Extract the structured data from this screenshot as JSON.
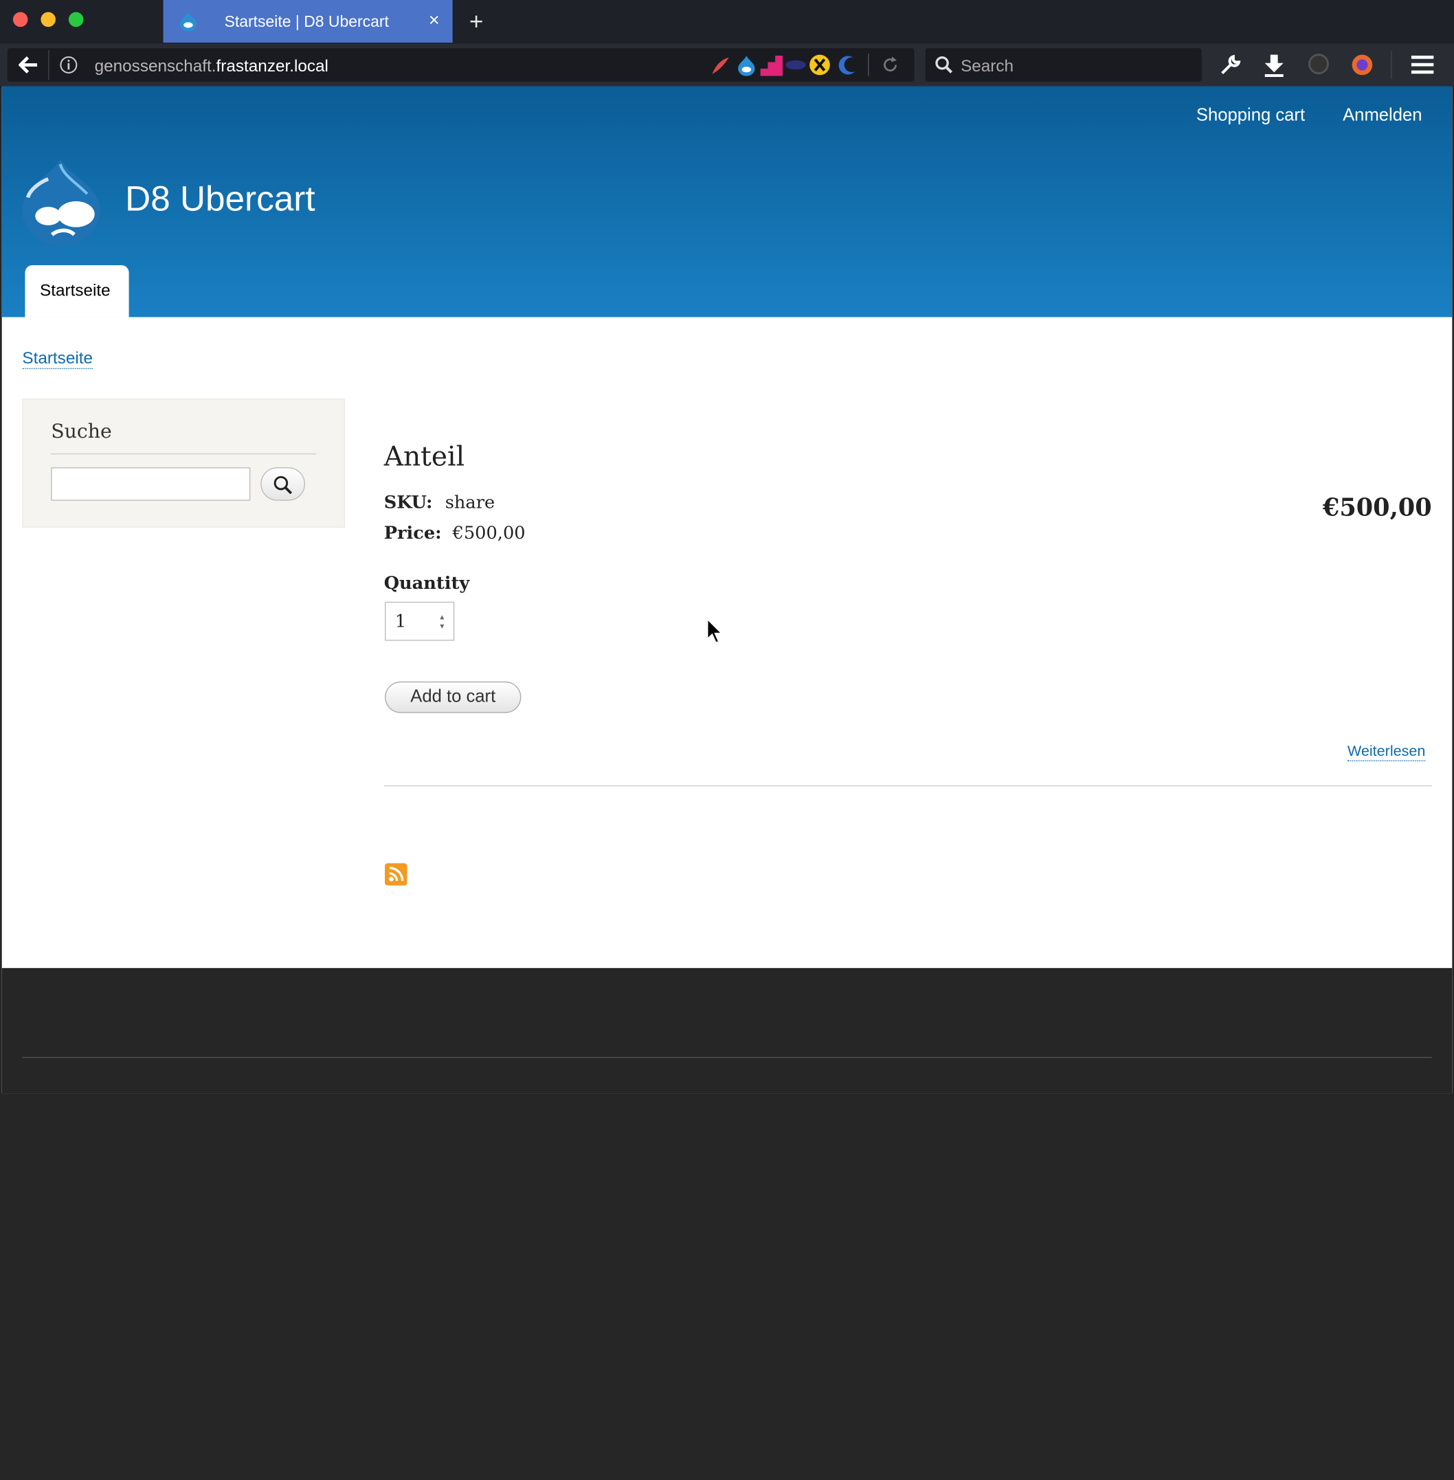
{
  "browser": {
    "tab_title": "Startseite | D8 Ubercart",
    "tab_close": "×",
    "new_tab": "+",
    "url_host_prefix": "genossenschaft.",
    "url_host_domain": "frastanzer.local",
    "search_placeholder": "Search"
  },
  "site": {
    "nav": {
      "shopping_cart": "Shopping cart",
      "login": "Anmelden"
    },
    "name": "D8 Ubercart",
    "primary_tab": "Startseite",
    "breadcrumb": "Startseite"
  },
  "sidebar": {
    "search_title": "Suche",
    "search_value": ""
  },
  "product": {
    "title": "Anteil",
    "sku_label": "SKU:",
    "sku_value": "share",
    "price_label": "Price:",
    "price_value": "€500,00",
    "display_price": "€500,00",
    "quantity_label": "Quantity",
    "quantity_value": "1",
    "add_to_cart": "Add to cart",
    "read_more": "Weiterlesen"
  },
  "colors": {
    "header_top": "#0b5d96",
    "header_bottom": "#1a80c3",
    "link": "#0e6ab0",
    "footer": "#262626"
  }
}
